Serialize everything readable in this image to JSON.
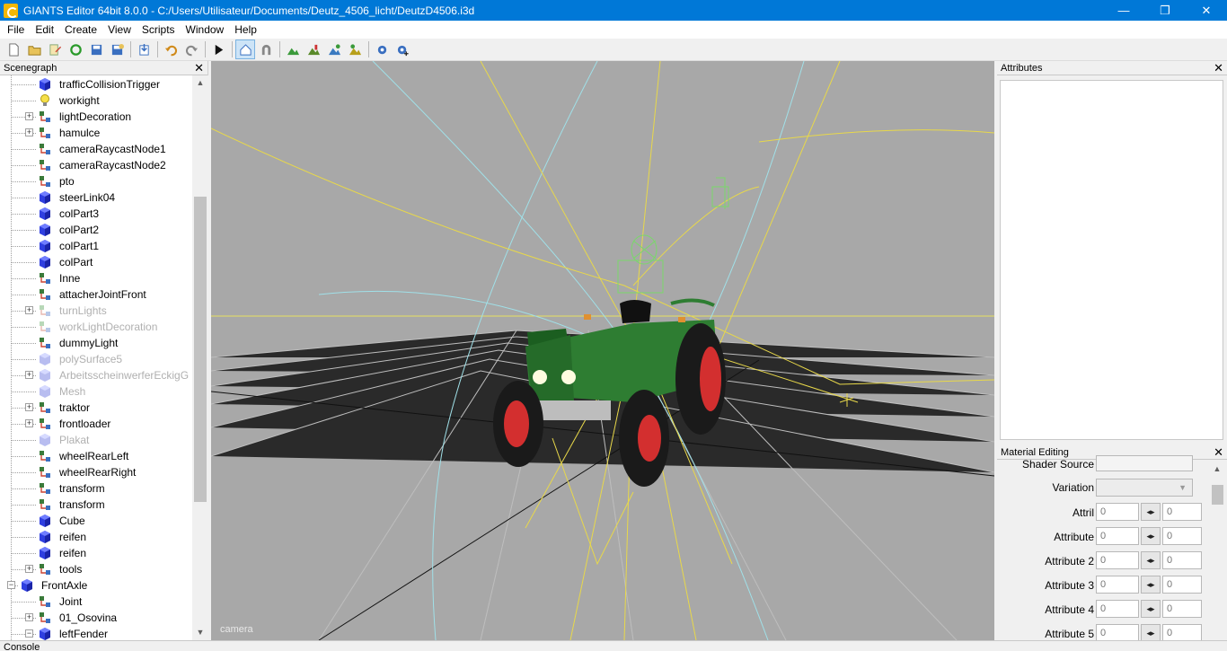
{
  "window": {
    "title": "GIANTS Editor 64bit 8.0.0 - C:/Users/Utilisateur/Documents/Deutz_4506_licht/DeutzD4506.i3d",
    "minimize": "—",
    "maximize": "❐",
    "close": "✕"
  },
  "menu": [
    "File",
    "Edit",
    "Create",
    "View",
    "Scripts",
    "Window",
    "Help"
  ],
  "toolbar_icons": [
    "new-file-icon",
    "open-file-icon",
    "edit-file-icon",
    "refresh-icon",
    "save-icon",
    "save-as-icon",
    "import-icon",
    "undo-icon",
    "redo-icon",
    "play-icon",
    "home-icon",
    "magnet-icon",
    "terrain-paint-icon",
    "terrain-sculpt-icon",
    "foliage-paint-icon",
    "decal-paint-icon",
    "settings-icon",
    "settings-plus-icon"
  ],
  "scenegraph": {
    "title": "Scenegraph",
    "close": "✕",
    "nodes": [
      {
        "label": "trafficCollisionTrigger",
        "icon": "shape",
        "expand": "",
        "dim": false
      },
      {
        "label": "workight",
        "icon": "light",
        "expand": "",
        "dim": false
      },
      {
        "label": "lightDecoration",
        "icon": "transform",
        "expand": "+",
        "dim": false
      },
      {
        "label": "hamulce",
        "icon": "transform",
        "expand": "+",
        "dim": false
      },
      {
        "label": "cameraRaycastNode1",
        "icon": "transform",
        "expand": "",
        "dim": false
      },
      {
        "label": "cameraRaycastNode2",
        "icon": "transform",
        "expand": "",
        "dim": false
      },
      {
        "label": "pto",
        "icon": "transform",
        "expand": "",
        "dim": false
      },
      {
        "label": "steerLink04",
        "icon": "shape",
        "expand": "",
        "dim": false
      },
      {
        "label": "colPart3",
        "icon": "shape",
        "expand": "",
        "dim": false
      },
      {
        "label": "colPart2",
        "icon": "shape",
        "expand": "",
        "dim": false
      },
      {
        "label": "colPart1",
        "icon": "shape",
        "expand": "",
        "dim": false
      },
      {
        "label": "colPart",
        "icon": "shape",
        "expand": "",
        "dim": false
      },
      {
        "label": "Inne",
        "icon": "transform",
        "expand": "",
        "dim": false
      },
      {
        "label": "attacherJointFront",
        "icon": "transform",
        "expand": "",
        "dim": false
      },
      {
        "label": "turnLights",
        "icon": "transform",
        "expand": "+",
        "dim": true
      },
      {
        "label": "workLightDecoration",
        "icon": "transform",
        "expand": "",
        "dim": true
      },
      {
        "label": "dummyLight",
        "icon": "transform",
        "expand": "",
        "dim": false
      },
      {
        "label": "polySurface5",
        "icon": "shape",
        "expand": "",
        "dim": true
      },
      {
        "label": "ArbeitsscheinwerferEckigG",
        "icon": "shape",
        "expand": "+",
        "dim": true
      },
      {
        "label": "Mesh",
        "icon": "shape",
        "expand": "",
        "dim": true
      },
      {
        "label": "traktor",
        "icon": "transform",
        "expand": "+",
        "dim": false
      },
      {
        "label": "frontloader",
        "icon": "transform",
        "expand": "+",
        "dim": false
      },
      {
        "label": "Plakat",
        "icon": "shape",
        "expand": "",
        "dim": true
      },
      {
        "label": "wheelRearLeft",
        "icon": "transform",
        "expand": "",
        "dim": false
      },
      {
        "label": "wheelRearRight",
        "icon": "transform",
        "expand": "",
        "dim": false
      },
      {
        "label": "transform",
        "icon": "transform",
        "expand": "",
        "dim": false
      },
      {
        "label": "transform",
        "icon": "transform",
        "expand": "",
        "dim": false
      },
      {
        "label": "Cube",
        "icon": "shape",
        "expand": "",
        "dim": false
      },
      {
        "label": "reifen",
        "icon": "shape",
        "expand": "",
        "dim": false
      },
      {
        "label": "reifen",
        "icon": "shape",
        "expand": "",
        "dim": false
      },
      {
        "label": "tools",
        "icon": "transform",
        "expand": "+",
        "dim": false
      },
      {
        "label": "FrontAxle",
        "icon": "shape",
        "expand": "−",
        "dim": false,
        "level": 0
      },
      {
        "label": "Joint",
        "icon": "transform",
        "expand": "",
        "dim": false
      },
      {
        "label": "01_Osovina",
        "icon": "transform",
        "expand": "+",
        "dim": false
      },
      {
        "label": "leftFender",
        "icon": "shape",
        "expand": "−",
        "dim": false
      }
    ]
  },
  "viewport": {
    "camera_label": "camera"
  },
  "attributes": {
    "title": "Attributes",
    "close": "✕"
  },
  "material_editing": {
    "title": "Material Editing",
    "close": "✕",
    "shader_source_label": "Shader Source",
    "variation_label": "Variation",
    "rows": [
      {
        "label": "Attril",
        "value1": "0",
        "value2": "0"
      },
      {
        "label": "Attribute",
        "value1": "0",
        "value2": "0"
      },
      {
        "label": "Attribute 2",
        "value1": "0",
        "value2": "0"
      },
      {
        "label": "Attribute 3",
        "value1": "0",
        "value2": "0"
      },
      {
        "label": "Attribute 4",
        "value1": "0",
        "value2": "0"
      },
      {
        "label": "Attribute 5",
        "value1": "0",
        "value2": "0"
      }
    ]
  },
  "console": {
    "title": "Console"
  }
}
